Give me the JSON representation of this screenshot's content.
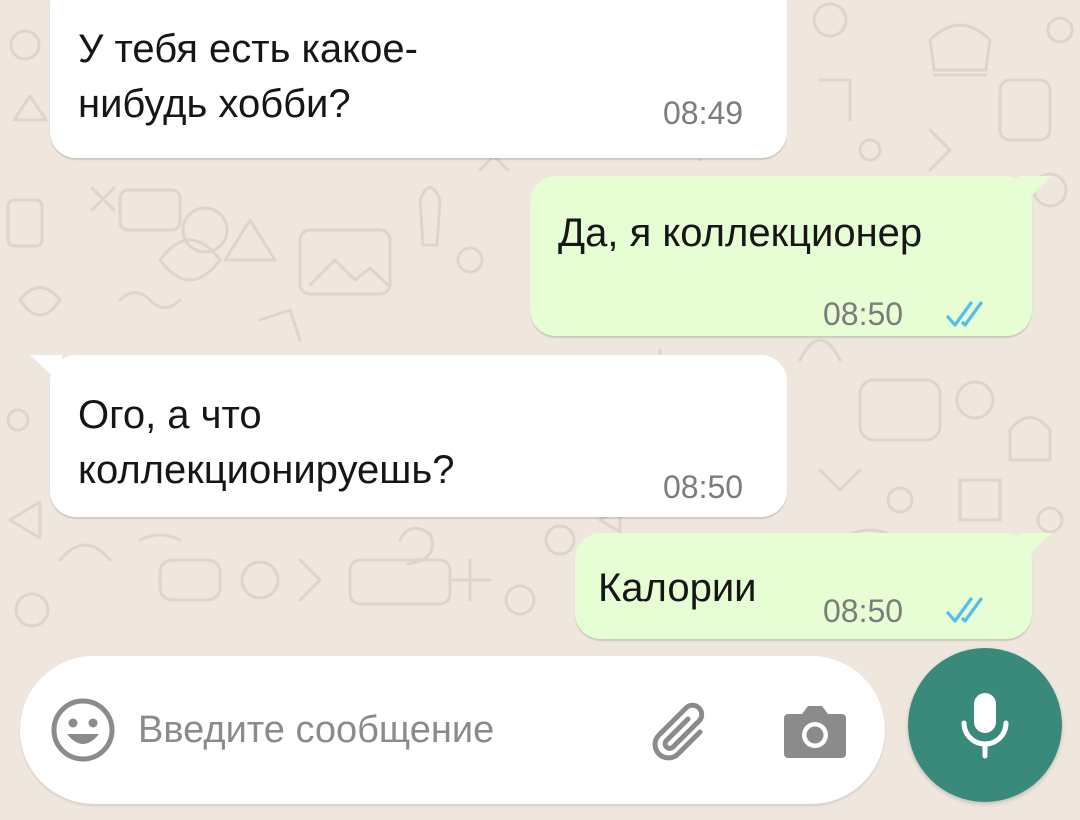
{
  "chat": {
    "messages": [
      {
        "direction": "incoming",
        "text": "У тебя есть какое-\nнибудь хобби?",
        "time": "08:49"
      },
      {
        "direction": "outgoing",
        "text": "Да, я коллекционер",
        "time": "08:50",
        "status": "read"
      },
      {
        "direction": "incoming",
        "text": "Ого, а что\nколлекционируешь?",
        "time": "08:50"
      },
      {
        "direction": "outgoing",
        "text": "Калории",
        "time": "08:50",
        "status": "read"
      }
    ]
  },
  "composer": {
    "placeholder": "Введите сообщение",
    "value": ""
  },
  "icons": {
    "emoji": "emoji-icon",
    "attach": "paperclip-icon",
    "camera": "camera-icon",
    "mic": "microphone-icon",
    "read_receipt": "double-check-icon"
  },
  "colors": {
    "chat_background": "#efe7dd",
    "incoming_bubble": "#ffffff",
    "outgoing_bubble": "#e7fdd3",
    "read_ticks": "#53bdeb",
    "mic_button": "#3a8a7c"
  }
}
